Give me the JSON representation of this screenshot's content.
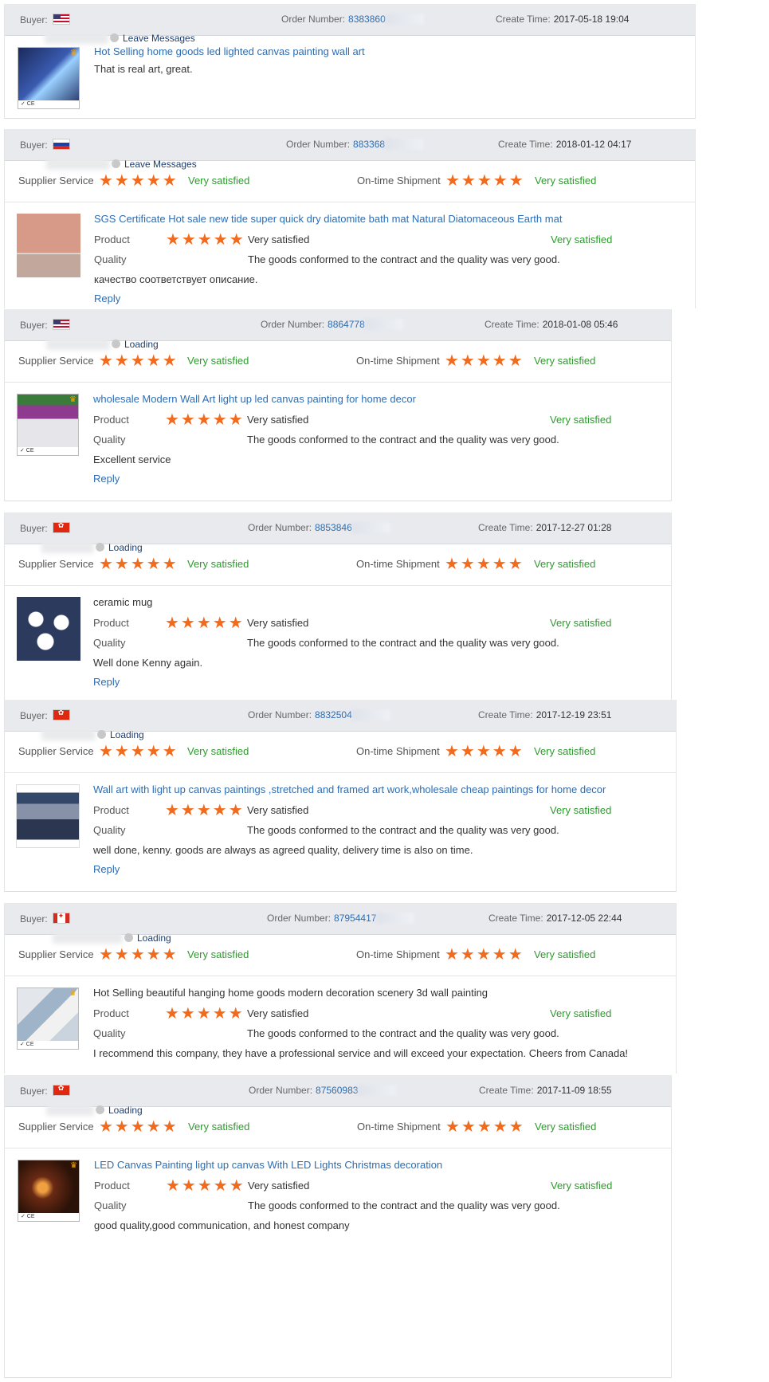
{
  "labels": {
    "buyer": "Buyer:",
    "order_number": "Order Number:",
    "create_time": "Create Time:",
    "supplier_service": "Supplier Service",
    "on_time_shipment": "On-time Shipment",
    "product": "Product",
    "quality": "Quality",
    "very_satisfied": "Very satisfied",
    "quality_text": "The goods conformed to the contract and the quality was very good.",
    "reply": "Reply",
    "stars": "★★★★★"
  },
  "colors": {
    "star": "#f26b1d",
    "satisfied": "#2e9a2e",
    "link": "#2d6db3",
    "header_bg": "#e8eaee"
  },
  "reviews": [
    {
      "flag": "us",
      "order": "8383860",
      "time": "2017-05-18 19:04",
      "status": "Leave Messages",
      "product_title": "Hot Selling home goods led lighted canvas painting wall art",
      "comment": "That is real art, great."
    },
    {
      "flag": "ru",
      "order": "883368",
      "time": "2018-01-12 04:17",
      "status": "Leave Messages",
      "product_title": "SGS Certificate Hot sale new tide super quick dry diatomite bath mat Natural Diatomaceous Earth mat",
      "comment": "качество соответствует описание."
    },
    {
      "flag": "us",
      "order": "8864778",
      "time": "2018-01-08 05:46",
      "status": "Loading",
      "product_title": "wholesale Modern Wall Art light up led canvas painting for home decor",
      "comment": "Excellent service"
    },
    {
      "flag": "hk",
      "order": "8853846",
      "time": "2017-12-27 01:28",
      "status": "Loading",
      "product_title": "ceramic mug",
      "comment": "Well done Kenny again."
    },
    {
      "flag": "hk",
      "order": "8832504",
      "time": "2017-12-19 23:51",
      "status": "Loading",
      "product_title": "Wall art with light up canvas paintings ,stretched and framed art work,wholesale cheap paintings for home decor",
      "comment": "well done, kenny. goods are always as agreed quality, delivery time is also on time."
    },
    {
      "flag": "ca",
      "order": "87954417",
      "time": "2017-12-05 22:44",
      "status": "Loading",
      "product_title": "Hot Selling beautiful hanging home goods modern decoration scenery 3d wall painting",
      "comment": "I recommend this company, they have a professional service and will exceed your expectation. Cheers from Canada!"
    },
    {
      "flag": "hk",
      "order": "87560983",
      "time": "2017-11-09 18:55",
      "status": "Loading",
      "product_title": "LED Canvas Painting light up canvas With LED Lights Christmas decoration",
      "comment": "good quality,good communication, and honest company"
    }
  ]
}
